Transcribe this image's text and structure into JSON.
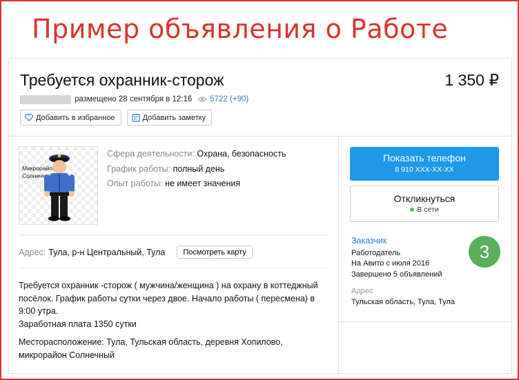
{
  "banner": "Пример объявления о Работе",
  "listing": {
    "title": "Требуется охранник-сторож",
    "price": "1 350 ₽",
    "posted": "размещено 28 сентября в 12:16",
    "views": "5722 (+90)"
  },
  "actions": {
    "favorite_label": "Добавить в избранное",
    "note_label": "Добавить заметку"
  },
  "photo": {
    "label": "Микрорайон\nСолнечный"
  },
  "params": [
    {
      "key": "Сфера деятельности:",
      "value": "Охрана, безопасность"
    },
    {
      "key": "График работы:",
      "value": "полный день"
    },
    {
      "key": "Опыт работы:",
      "value": "не имеет значения"
    }
  ],
  "address": {
    "key": "Адрес:",
    "value": "Тула, р-н Центральный, Тула",
    "map_label": "Посмотреть карту"
  },
  "description": {
    "p1": "Требуется охранник -сторож ( мужчина/женщина ) на охрану в коттеджный посёлок. График работы сутки через двое. Начало работы ( пересмена) в 9:00 утра.",
    "p1b": "Заработная плата 1350 сутки",
    "p2": "Месторасположение: Тула, Тульская область, деревня Хопилово, микрорайон Солнечный"
  },
  "contact": {
    "phone_label": "Показать телефон",
    "phone_number": "8 910 XXX-XX-XX",
    "respond_label": "Откликнуться",
    "status": "В сети"
  },
  "seller": {
    "name": "Заказчик",
    "type": "Работодатель",
    "since": "На Авито с июля 2016",
    "completed": "Завершено 5 объявлений",
    "address_label": "Адрес",
    "address": "Тульская область, Тула, Тула",
    "badge": "3"
  },
  "colors": {
    "accent": "#1f98ea",
    "banner": "#d9342b",
    "online": "#5cb85c",
    "badge": "#58b05a",
    "link": "#2b7cd3"
  },
  "icons": [
    "heart-icon",
    "note-icon",
    "eye-icon"
  ]
}
